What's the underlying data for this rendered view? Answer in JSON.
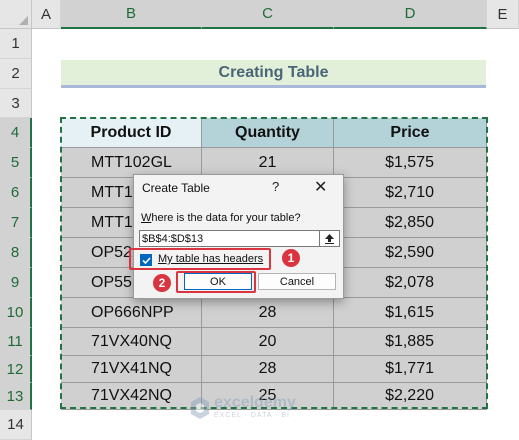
{
  "sheet": {
    "columns": [
      "A",
      "B",
      "C",
      "D",
      "E"
    ],
    "rows": [
      "1",
      "2",
      "3",
      "4",
      "5",
      "6",
      "7",
      "8",
      "9",
      "10",
      "11",
      "12",
      "13",
      "14"
    ]
  },
  "title": "Creating Table",
  "table": {
    "headers": [
      "Product ID",
      "Quantity",
      "Price"
    ],
    "rows": [
      [
        "MTT102GL",
        "21",
        "$1,575"
      ],
      [
        "MTT1",
        "",
        "$2,710"
      ],
      [
        "MTT1",
        "",
        "$2,850"
      ],
      [
        "OP52",
        "",
        "$2,590"
      ],
      [
        "OP55",
        "",
        "$2,078"
      ],
      [
        "OP666NPP",
        "28",
        "$1,615"
      ],
      [
        "71VX40NQ",
        "20",
        "$1,885"
      ],
      [
        "71VX41NQ",
        "28",
        "$1,771"
      ],
      [
        "71VX42NQ",
        "25",
        "$2,220"
      ]
    ]
  },
  "dialog": {
    "title": "Create Table",
    "help": "?",
    "close": "✕",
    "prompt": "Where is the data for your table?",
    "range_value": "$B$4:$D$13",
    "checkbox_label": "My table has headers",
    "checkbox_checked": true,
    "ok_label": "OK",
    "cancel_label": "Cancel"
  },
  "callouts": {
    "one": "1",
    "two": "2"
  },
  "watermark": {
    "name": "exceldemy",
    "tagline": "EXCEL · DATA · BI"
  },
  "colors": {
    "accent": "#217346",
    "callout": "#d9343f",
    "header_fill": "#b4d3d9",
    "data_fill": "#d0d0d0",
    "title_fill": "#e2efd9"
  },
  "icons": [
    "collapse-range-icon",
    "close-icon",
    "help-icon",
    "check-icon",
    "select-all-icon",
    "watermark-logo-icon"
  ]
}
